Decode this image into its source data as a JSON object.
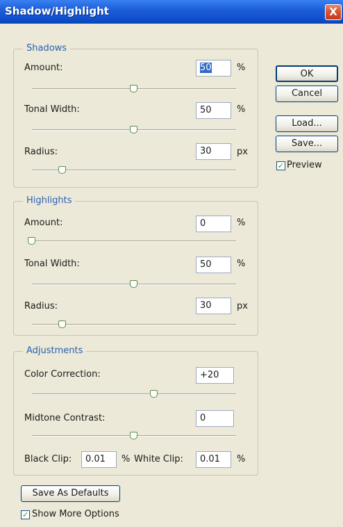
{
  "window": {
    "title": "Shadow/Highlight",
    "close_glyph": "X"
  },
  "shadows": {
    "legend": "Shadows",
    "amount": {
      "label": "Amount:",
      "value": "50",
      "unit": "%",
      "slider_fraction": 0.5
    },
    "tonal_width": {
      "label": "Tonal Width:",
      "value": "50",
      "unit": "%",
      "slider_fraction": 0.5
    },
    "radius": {
      "label": "Radius:",
      "value": "30",
      "unit": "px",
      "slider_fraction": 0.15
    }
  },
  "highlights": {
    "legend": "Highlights",
    "amount": {
      "label": "Amount:",
      "value": "0",
      "unit": "%",
      "slider_fraction": 0.0
    },
    "tonal_width": {
      "label": "Tonal Width:",
      "value": "50",
      "unit": "%",
      "slider_fraction": 0.5
    },
    "radius": {
      "label": "Radius:",
      "value": "30",
      "unit": "px",
      "slider_fraction": 0.15
    }
  },
  "adjustments": {
    "legend": "Adjustments",
    "color_correction": {
      "label": "Color Correction:",
      "value": "+20",
      "slider_fraction": 0.6
    },
    "midtone_contrast": {
      "label": "Midtone Contrast:",
      "value": "0",
      "slider_fraction": 0.5
    },
    "black_clip": {
      "label": "Black Clip:",
      "value": "0.01",
      "unit": "%"
    },
    "white_clip": {
      "label": "White Clip:",
      "value": "0.01",
      "unit": "%"
    }
  },
  "buttons": {
    "ok": "OK",
    "cancel": "Cancel",
    "load": "Load...",
    "save": "Save...",
    "save_defaults": "Save As Defaults"
  },
  "preview": {
    "label": "Preview",
    "checked": true
  },
  "show_more": {
    "label": "Show More Options",
    "checked": true
  },
  "checkmark": "✓",
  "colors": {
    "accent": "#2b5fb3",
    "selection": "#316ac5",
    "titlebar": "#0f4fcc",
    "close": "#d8502c"
  }
}
